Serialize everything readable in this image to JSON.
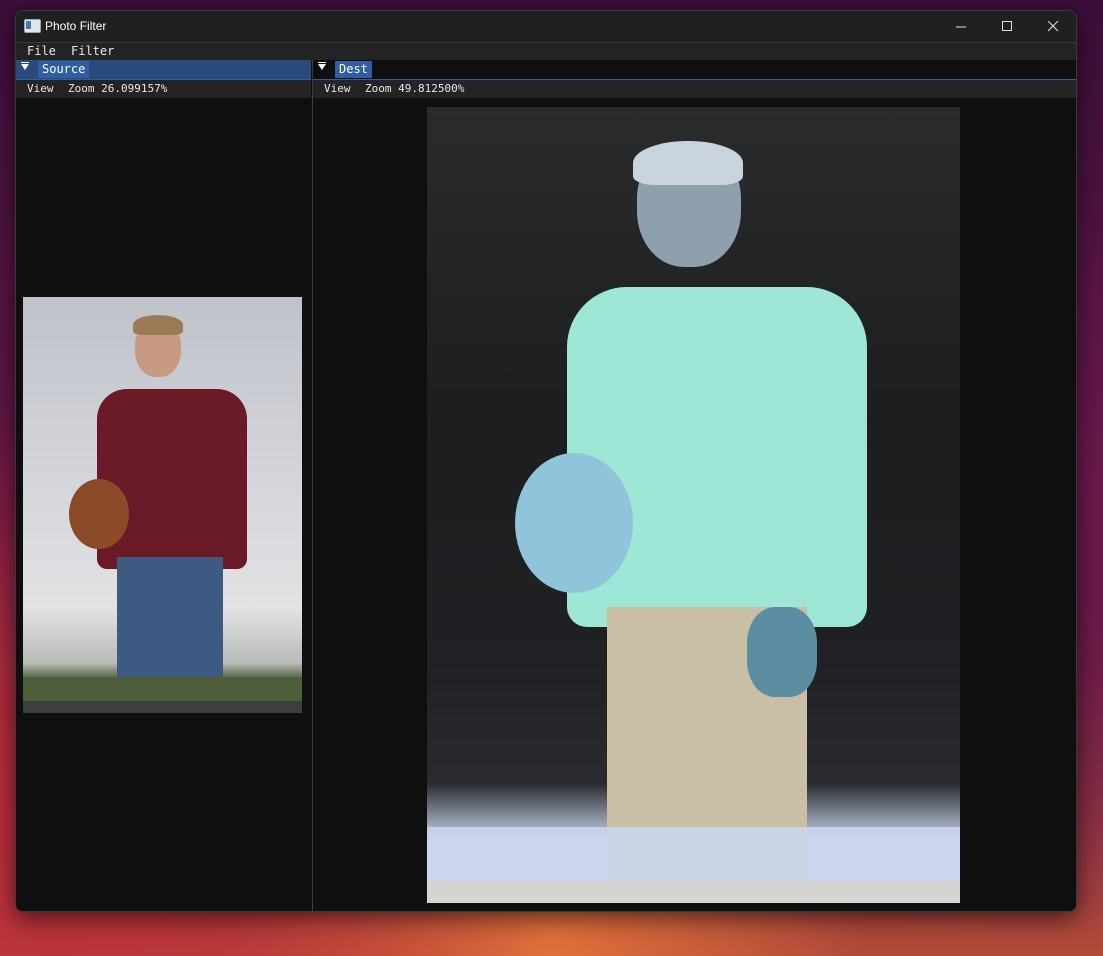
{
  "window": {
    "title": "Photo Filter",
    "icons": {
      "app": "app-window-icon",
      "minimize": "minimize-icon",
      "maximize": "maximize-icon",
      "close": "close-icon"
    }
  },
  "menu": {
    "items": [
      "File",
      "Filter"
    ]
  },
  "source_panel": {
    "tab_label": "Source",
    "view_label": "View",
    "zoom_text": "Zoom 26.099157%"
  },
  "dest_panel": {
    "tab_label": "Dest",
    "view_label": "View",
    "zoom_text": "Zoom 49.812500%"
  },
  "colors": {
    "accent": "#2f5ea3",
    "window_bg": "#0f0f0f",
    "titlebar": "#202020"
  }
}
